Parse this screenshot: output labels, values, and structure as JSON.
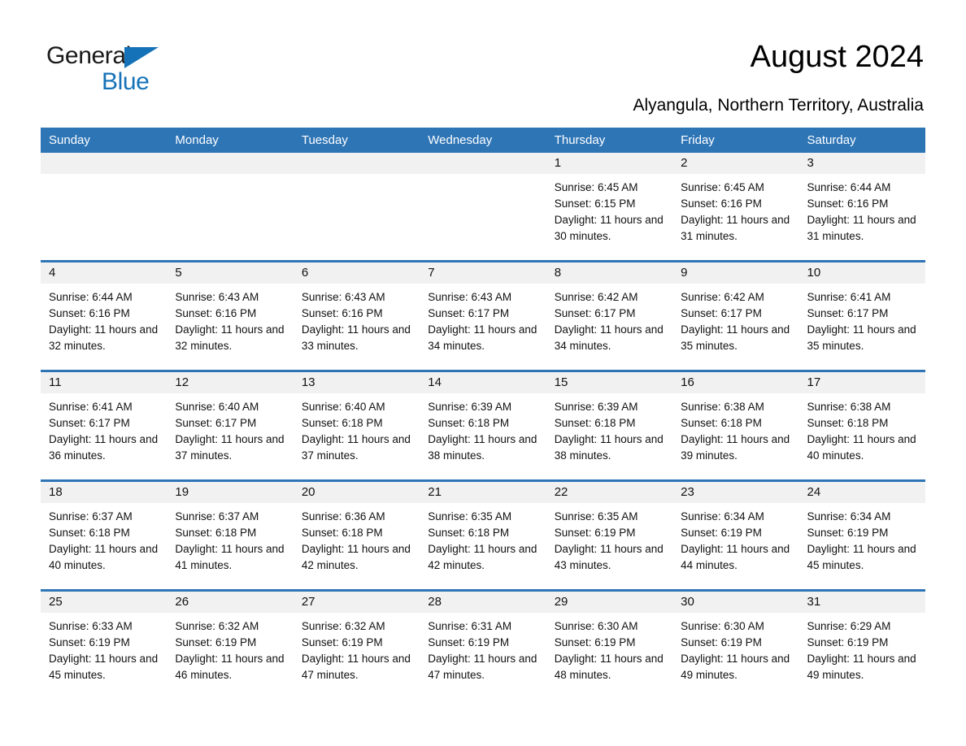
{
  "brand": {
    "name_part1": "General",
    "name_part2": "Blue",
    "logo_color": "#1572b8",
    "triangle_icon": "triangle-icon"
  },
  "header": {
    "title": "August 2024",
    "subtitle": "Alyangula, Northern Territory, Australia"
  },
  "theme": {
    "header_blue": "#2e75b6",
    "row_divider_blue": "#2e75b6",
    "daynum_band_gray": "#f1f1f1",
    "page_background": "#ffffff",
    "text_color": "#111111"
  },
  "calendar": {
    "month": "August",
    "year": "2024",
    "weekday_headers": [
      "Sunday",
      "Monday",
      "Tuesday",
      "Wednesday",
      "Thursday",
      "Friday",
      "Saturday"
    ],
    "weeks": [
      [
        {
          "day": "",
          "sunrise": "",
          "sunset": "",
          "daylight": ""
        },
        {
          "day": "",
          "sunrise": "",
          "sunset": "",
          "daylight": ""
        },
        {
          "day": "",
          "sunrise": "",
          "sunset": "",
          "daylight": ""
        },
        {
          "day": "",
          "sunrise": "",
          "sunset": "",
          "daylight": ""
        },
        {
          "day": "1",
          "sunrise": "Sunrise: 6:45 AM",
          "sunset": "Sunset: 6:15 PM",
          "daylight": "Daylight: 11 hours and 30 minutes."
        },
        {
          "day": "2",
          "sunrise": "Sunrise: 6:45 AM",
          "sunset": "Sunset: 6:16 PM",
          "daylight": "Daylight: 11 hours and 31 minutes."
        },
        {
          "day": "3",
          "sunrise": "Sunrise: 6:44 AM",
          "sunset": "Sunset: 6:16 PM",
          "daylight": "Daylight: 11 hours and 31 minutes."
        }
      ],
      [
        {
          "day": "4",
          "sunrise": "Sunrise: 6:44 AM",
          "sunset": "Sunset: 6:16 PM",
          "daylight": "Daylight: 11 hours and 32 minutes."
        },
        {
          "day": "5",
          "sunrise": "Sunrise: 6:43 AM",
          "sunset": "Sunset: 6:16 PM",
          "daylight": "Daylight: 11 hours and 32 minutes."
        },
        {
          "day": "6",
          "sunrise": "Sunrise: 6:43 AM",
          "sunset": "Sunset: 6:16 PM",
          "daylight": "Daylight: 11 hours and 33 minutes."
        },
        {
          "day": "7",
          "sunrise": "Sunrise: 6:43 AM",
          "sunset": "Sunset: 6:17 PM",
          "daylight": "Daylight: 11 hours and 34 minutes."
        },
        {
          "day": "8",
          "sunrise": "Sunrise: 6:42 AM",
          "sunset": "Sunset: 6:17 PM",
          "daylight": "Daylight: 11 hours and 34 minutes."
        },
        {
          "day": "9",
          "sunrise": "Sunrise: 6:42 AM",
          "sunset": "Sunset: 6:17 PM",
          "daylight": "Daylight: 11 hours and 35 minutes."
        },
        {
          "day": "10",
          "sunrise": "Sunrise: 6:41 AM",
          "sunset": "Sunset: 6:17 PM",
          "daylight": "Daylight: 11 hours and 35 minutes."
        }
      ],
      [
        {
          "day": "11",
          "sunrise": "Sunrise: 6:41 AM",
          "sunset": "Sunset: 6:17 PM",
          "daylight": "Daylight: 11 hours and 36 minutes."
        },
        {
          "day": "12",
          "sunrise": "Sunrise: 6:40 AM",
          "sunset": "Sunset: 6:17 PM",
          "daylight": "Daylight: 11 hours and 37 minutes."
        },
        {
          "day": "13",
          "sunrise": "Sunrise: 6:40 AM",
          "sunset": "Sunset: 6:18 PM",
          "daylight": "Daylight: 11 hours and 37 minutes."
        },
        {
          "day": "14",
          "sunrise": "Sunrise: 6:39 AM",
          "sunset": "Sunset: 6:18 PM",
          "daylight": "Daylight: 11 hours and 38 minutes."
        },
        {
          "day": "15",
          "sunrise": "Sunrise: 6:39 AM",
          "sunset": "Sunset: 6:18 PM",
          "daylight": "Daylight: 11 hours and 38 minutes."
        },
        {
          "day": "16",
          "sunrise": "Sunrise: 6:38 AM",
          "sunset": "Sunset: 6:18 PM",
          "daylight": "Daylight: 11 hours and 39 minutes."
        },
        {
          "day": "17",
          "sunrise": "Sunrise: 6:38 AM",
          "sunset": "Sunset: 6:18 PM",
          "daylight": "Daylight: 11 hours and 40 minutes."
        }
      ],
      [
        {
          "day": "18",
          "sunrise": "Sunrise: 6:37 AM",
          "sunset": "Sunset: 6:18 PM",
          "daylight": "Daylight: 11 hours and 40 minutes."
        },
        {
          "day": "19",
          "sunrise": "Sunrise: 6:37 AM",
          "sunset": "Sunset: 6:18 PM",
          "daylight": "Daylight: 11 hours and 41 minutes."
        },
        {
          "day": "20",
          "sunrise": "Sunrise: 6:36 AM",
          "sunset": "Sunset: 6:18 PM",
          "daylight": "Daylight: 11 hours and 42 minutes."
        },
        {
          "day": "21",
          "sunrise": "Sunrise: 6:35 AM",
          "sunset": "Sunset: 6:18 PM",
          "daylight": "Daylight: 11 hours and 42 minutes."
        },
        {
          "day": "22",
          "sunrise": "Sunrise: 6:35 AM",
          "sunset": "Sunset: 6:19 PM",
          "daylight": "Daylight: 11 hours and 43 minutes."
        },
        {
          "day": "23",
          "sunrise": "Sunrise: 6:34 AM",
          "sunset": "Sunset: 6:19 PM",
          "daylight": "Daylight: 11 hours and 44 minutes."
        },
        {
          "day": "24",
          "sunrise": "Sunrise: 6:34 AM",
          "sunset": "Sunset: 6:19 PM",
          "daylight": "Daylight: 11 hours and 45 minutes."
        }
      ],
      [
        {
          "day": "25",
          "sunrise": "Sunrise: 6:33 AM",
          "sunset": "Sunset: 6:19 PM",
          "daylight": "Daylight: 11 hours and 45 minutes."
        },
        {
          "day": "26",
          "sunrise": "Sunrise: 6:32 AM",
          "sunset": "Sunset: 6:19 PM",
          "daylight": "Daylight: 11 hours and 46 minutes."
        },
        {
          "day": "27",
          "sunrise": "Sunrise: 6:32 AM",
          "sunset": "Sunset: 6:19 PM",
          "daylight": "Daylight: 11 hours and 47 minutes."
        },
        {
          "day": "28",
          "sunrise": "Sunrise: 6:31 AM",
          "sunset": "Sunset: 6:19 PM",
          "daylight": "Daylight: 11 hours and 47 minutes."
        },
        {
          "day": "29",
          "sunrise": "Sunrise: 6:30 AM",
          "sunset": "Sunset: 6:19 PM",
          "daylight": "Daylight: 11 hours and 48 minutes."
        },
        {
          "day": "30",
          "sunrise": "Sunrise: 6:30 AM",
          "sunset": "Sunset: 6:19 PM",
          "daylight": "Daylight: 11 hours and 49 minutes."
        },
        {
          "day": "31",
          "sunrise": "Sunrise: 6:29 AM",
          "sunset": "Sunset: 6:19 PM",
          "daylight": "Daylight: 11 hours and 49 minutes."
        }
      ]
    ]
  }
}
